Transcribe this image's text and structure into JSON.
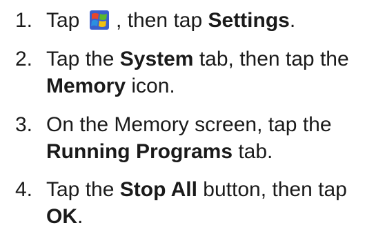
{
  "steps": [
    {
      "number": "1.",
      "pre": "Tap ",
      "icon": "windows-start-flag-icon",
      "post": " , then tap ",
      "bold": "Settings",
      "end": "."
    },
    {
      "number": "2.",
      "pre": "Tap the ",
      "bold1": "System",
      "mid": " tab, then tap the",
      "bold2": "Memory",
      "end": " icon."
    },
    {
      "number": "3.",
      "line1": "On the Memory screen, tap the",
      "bold": "Running Programs",
      "end": " tab."
    },
    {
      "number": "4.",
      "pre": "Tap the ",
      "bold1": "Stop All",
      "mid": " button, then tap",
      "bold2": "OK",
      "end": "."
    }
  ]
}
